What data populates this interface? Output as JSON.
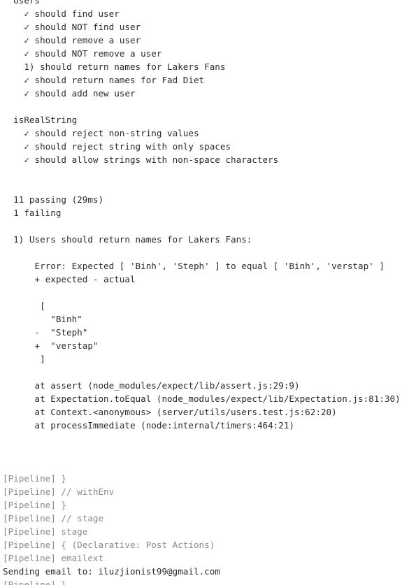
{
  "console": {
    "colors": {
      "text": "#2b2b2b",
      "pipeline": "#8a8a8a",
      "background": "#ffffff"
    },
    "lines": [
      {
        "text": "  Users",
        "style": "normal"
      },
      {
        "text": "    ✓ should find user",
        "style": "normal"
      },
      {
        "text": "    ✓ should NOT find user",
        "style": "normal"
      },
      {
        "text": "    ✓ should remove a user",
        "style": "normal"
      },
      {
        "text": "    ✓ should NOT remove a user",
        "style": "normal"
      },
      {
        "text": "    1) should return names for Lakers Fans",
        "style": "normal"
      },
      {
        "text": "    ✓ should return names for Fad Diet",
        "style": "normal"
      },
      {
        "text": "    ✓ should add new user",
        "style": "normal"
      },
      {
        "text": "",
        "style": "normal"
      },
      {
        "text": "  isRealString",
        "style": "normal"
      },
      {
        "text": "    ✓ should reject non-string values",
        "style": "normal"
      },
      {
        "text": "    ✓ should reject string with only spaces",
        "style": "normal"
      },
      {
        "text": "    ✓ should allow strings with non-space characters",
        "style": "normal"
      },
      {
        "text": "",
        "style": "normal"
      },
      {
        "text": "",
        "style": "normal"
      },
      {
        "text": "  11 passing (29ms)",
        "style": "normal"
      },
      {
        "text": "  1 failing",
        "style": "normal"
      },
      {
        "text": "",
        "style": "normal"
      },
      {
        "text": "  1) Users should return names for Lakers Fans:",
        "style": "normal"
      },
      {
        "text": "",
        "style": "normal"
      },
      {
        "text": "      Error: Expected [ 'Binh', 'Steph' ] to equal [ 'Binh', 'verstap' ]",
        "style": "normal"
      },
      {
        "text": "      + expected - actual",
        "style": "normal"
      },
      {
        "text": "",
        "style": "normal"
      },
      {
        "text": "       [",
        "style": "normal"
      },
      {
        "text": "         \"Binh\"",
        "style": "normal"
      },
      {
        "text": "      -  \"Steph\"",
        "style": "normal"
      },
      {
        "text": "      +  \"verstap\"",
        "style": "normal"
      },
      {
        "text": "       ]",
        "style": "normal"
      },
      {
        "text": "",
        "style": "normal"
      },
      {
        "text": "      at assert (node_modules/expect/lib/assert.js:29:9)",
        "style": "normal"
      },
      {
        "text": "      at Expectation.toEqual (node_modules/expect/lib/Expectation.js:81:30)",
        "style": "normal"
      },
      {
        "text": "      at Context.<anonymous> (server/utils/users.test.js:62:20)",
        "style": "normal"
      },
      {
        "text": "      at processImmediate (node:internal/timers:464:21)",
        "style": "normal"
      },
      {
        "text": "",
        "style": "normal"
      },
      {
        "text": "",
        "style": "normal"
      },
      {
        "text": "",
        "style": "normal"
      },
      {
        "text": "[Pipeline] }",
        "style": "pipe"
      },
      {
        "text": "[Pipeline] // withEnv",
        "style": "pipe"
      },
      {
        "text": "[Pipeline] }",
        "style": "pipe"
      },
      {
        "text": "[Pipeline] // stage",
        "style": "pipe"
      },
      {
        "text": "[Pipeline] stage",
        "style": "pipe"
      },
      {
        "text": "[Pipeline] { (Declarative: Post Actions)",
        "style": "pipe"
      },
      {
        "text": "[Pipeline] emailext",
        "style": "pipe"
      },
      {
        "text": "Sending email to: iluzjionist99@gmail.com",
        "style": "normal"
      },
      {
        "text": "[Pipeline] }",
        "style": "pipe"
      }
    ]
  }
}
